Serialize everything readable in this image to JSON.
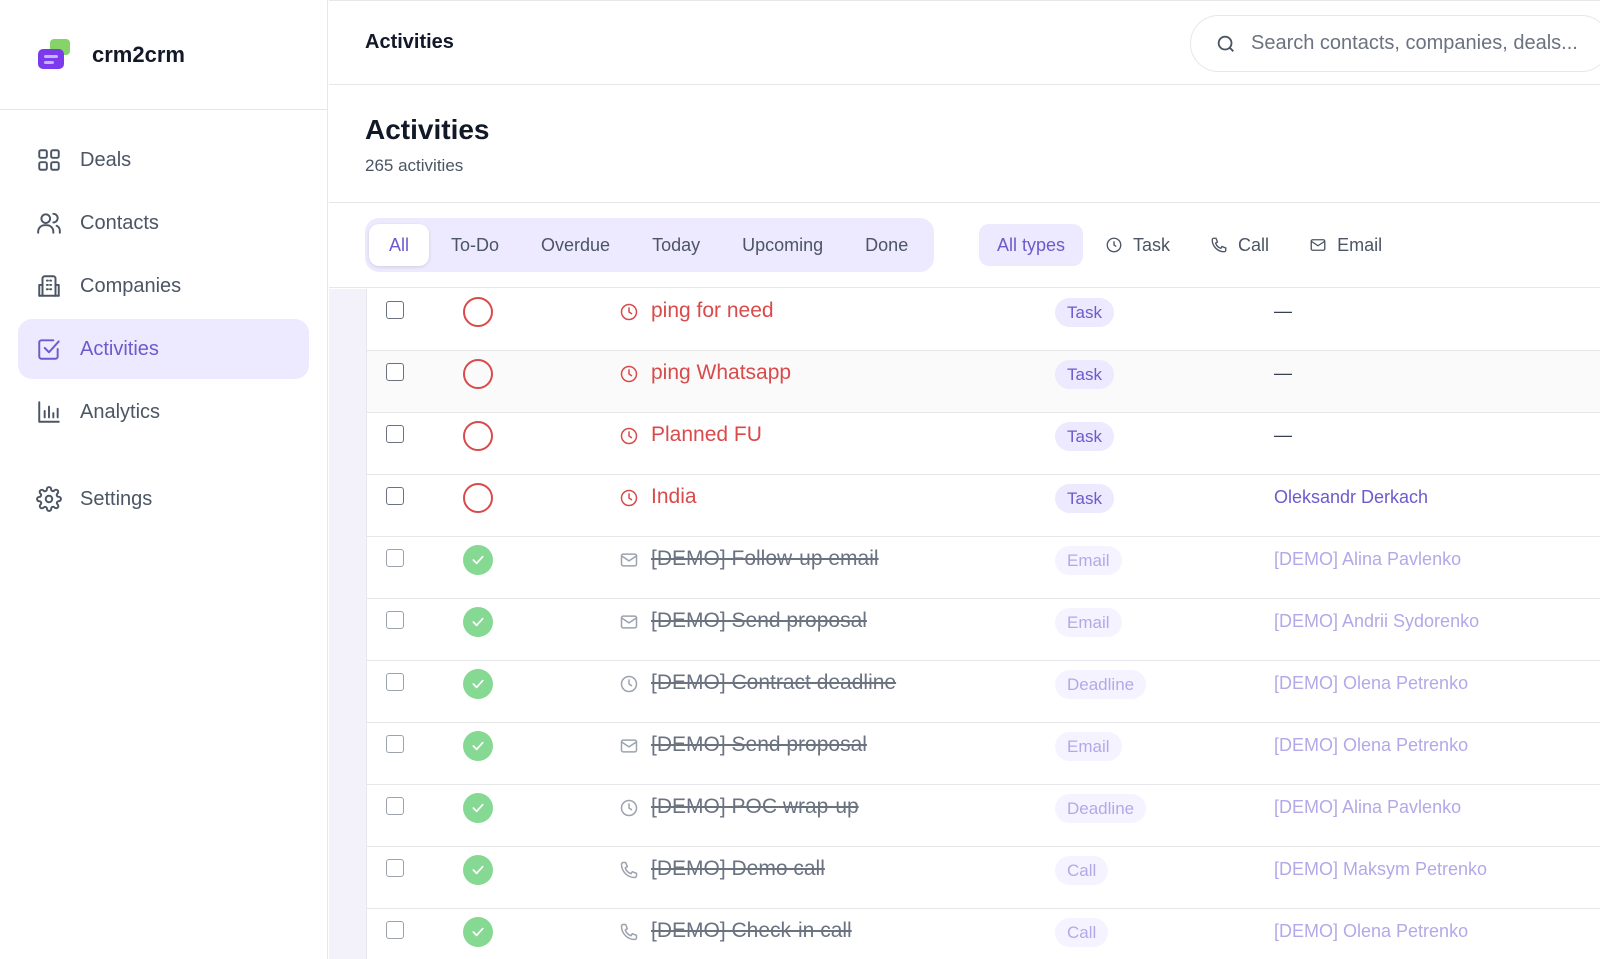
{
  "brand": {
    "name": "crm2crm"
  },
  "sidebar": {
    "items": [
      {
        "label": "Deals",
        "icon": "grid-icon"
      },
      {
        "label": "Contacts",
        "icon": "users-icon"
      },
      {
        "label": "Companies",
        "icon": "building-icon"
      },
      {
        "label": "Activities",
        "icon": "check-square-icon",
        "active": true
      },
      {
        "label": "Analytics",
        "icon": "bar-chart-icon"
      }
    ],
    "settings_label": "Settings"
  },
  "topbar": {
    "title": "Activities",
    "search_placeholder": "Search contacts, companies, deals..."
  },
  "page": {
    "title": "Activities",
    "count": "265 activities"
  },
  "filters": {
    "status_tabs": [
      "All",
      "To-Do",
      "Overdue",
      "Today",
      "Upcoming",
      "Done"
    ],
    "active_status": "All",
    "type_all": "All types",
    "types": [
      "Task",
      "Call",
      "Email"
    ]
  },
  "colors": {
    "accent": "#6d5acd",
    "accent_bg": "#ede9fe",
    "overdue": "#d94a4a",
    "done": "#86d993"
  },
  "rows": [
    {
      "state": "overdue",
      "icon": "clock-icon",
      "subject": "ping for need",
      "type": "Task",
      "contact": "—"
    },
    {
      "state": "overdue",
      "icon": "clock-icon",
      "subject": "ping Whatsapp",
      "type": "Task",
      "contact": "—"
    },
    {
      "state": "overdue",
      "icon": "clock-icon",
      "subject": "Planned FU",
      "type": "Task",
      "contact": "—"
    },
    {
      "state": "overdue",
      "icon": "clock-icon",
      "subject": "India",
      "type": "Task",
      "contact": "Oleksandr Derkach"
    },
    {
      "state": "done",
      "icon": "mail-icon",
      "subject": "[DEMO] Follow-up email",
      "type": "Email",
      "contact": "[DEMO] Alina Pavlenko"
    },
    {
      "state": "done",
      "icon": "mail-icon",
      "subject": "[DEMO] Send proposal",
      "type": "Email",
      "contact": "[DEMO] Andrii Sydorenko"
    },
    {
      "state": "done",
      "icon": "clock-icon",
      "subject": "[DEMO] Contract deadline",
      "type": "Deadline",
      "contact": "[DEMO] Olena Petrenko"
    },
    {
      "state": "done",
      "icon": "mail-icon",
      "subject": "[DEMO] Send proposal",
      "type": "Email",
      "contact": "[DEMO] Olena Petrenko"
    },
    {
      "state": "done",
      "icon": "clock-icon",
      "subject": "[DEMO] POC wrap-up",
      "type": "Deadline",
      "contact": "[DEMO] Alina Pavlenko"
    },
    {
      "state": "done",
      "icon": "phone-icon",
      "subject": "[DEMO] Demo call",
      "type": "Call",
      "contact": "[DEMO] Maksym Petrenko"
    },
    {
      "state": "done",
      "icon": "phone-icon",
      "subject": "[DEMO] Check-in call",
      "type": "Call",
      "contact": "[DEMO] Olena Petrenko"
    }
  ]
}
